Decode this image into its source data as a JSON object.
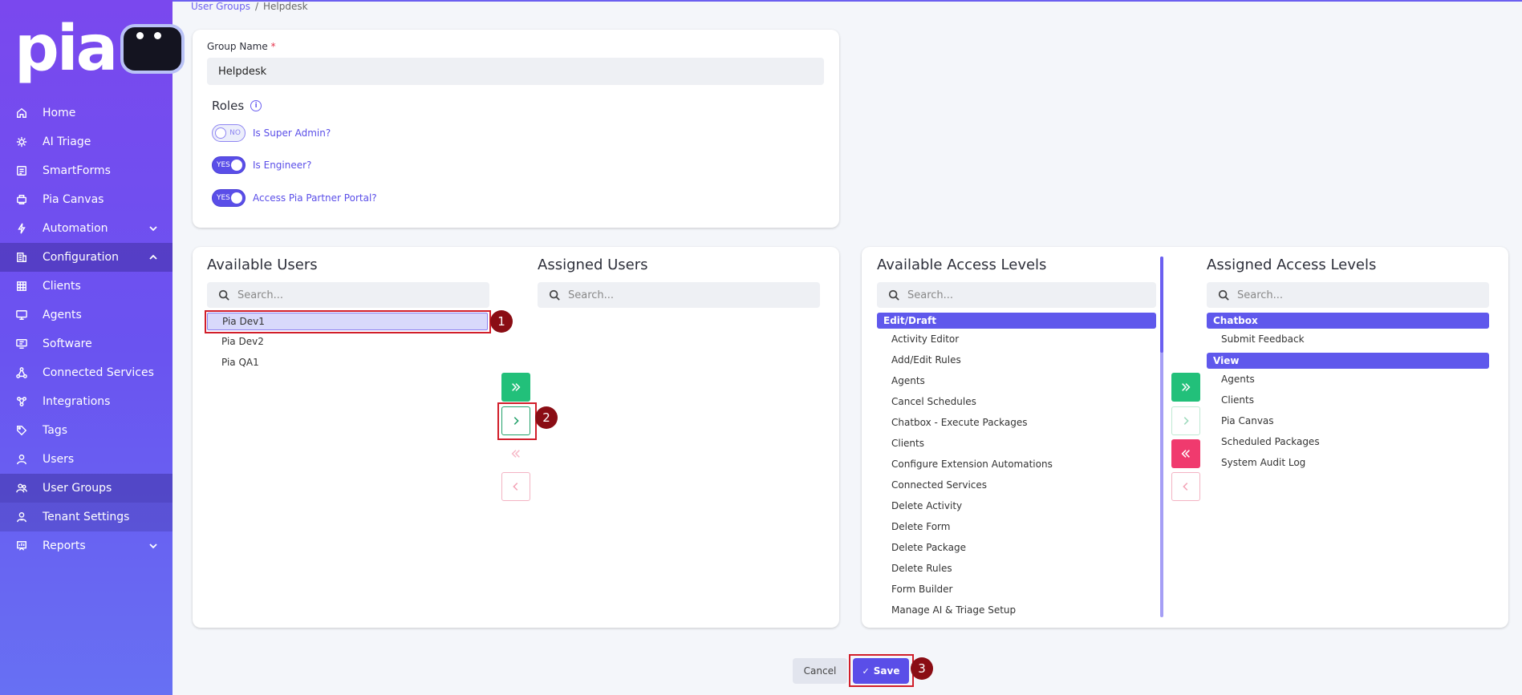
{
  "app": {
    "logo_text": "pia"
  },
  "sidebar": {
    "items": [
      {
        "label": "Home",
        "icon": "home-icon"
      },
      {
        "label": "AI Triage",
        "icon": "ai-triage-icon"
      },
      {
        "label": "SmartForms",
        "icon": "smartforms-icon"
      },
      {
        "label": "Pia Canvas",
        "icon": "canvas-icon"
      },
      {
        "label": "Automation",
        "icon": "automation-icon"
      },
      {
        "label": "Configuration",
        "icon": "configuration-icon"
      },
      {
        "label": "Clients",
        "icon": "clients-icon"
      },
      {
        "label": "Agents",
        "icon": "agents-icon"
      },
      {
        "label": "Software",
        "icon": "software-icon"
      },
      {
        "label": "Connected Services",
        "icon": "connected-services-icon"
      },
      {
        "label": "Integrations",
        "icon": "integrations-icon"
      },
      {
        "label": "Tags",
        "icon": "tag-icon"
      },
      {
        "label": "Users",
        "icon": "user-icon"
      },
      {
        "label": "User Groups",
        "icon": "user-groups-icon"
      },
      {
        "label": "Tenant Settings",
        "icon": "tenant-settings-icon"
      },
      {
        "label": "Reports",
        "icon": "reports-icon"
      }
    ]
  },
  "breadcrumb": {
    "parent": "User Groups",
    "separator": "/",
    "current": "Helpdesk"
  },
  "form": {
    "group_name_label": "Group Name",
    "required_mark": "*",
    "group_name_value": "Helpdesk",
    "roles_title": "Roles",
    "info_glyph": "i",
    "roles": [
      {
        "label": "Is Super Admin?",
        "state": "NO"
      },
      {
        "label": "Is Engineer?",
        "state": "YES"
      },
      {
        "label": "Access Pia Partner Portal?",
        "state": "YES"
      }
    ]
  },
  "users": {
    "available_title": "Available Users",
    "assigned_title": "Assigned Users",
    "search_placeholder": "Search...",
    "available": [
      "Pia Dev1",
      "Pia Dev2",
      "Pia QA1"
    ],
    "assigned": []
  },
  "access": {
    "available_title": "Available Access Levels",
    "assigned_title": "Assigned Access Levels",
    "search_placeholder": "Search...",
    "available_group": "Edit/Draft",
    "available": [
      "Activity Editor",
      "Add/Edit Rules",
      "Agents",
      "Cancel Schedules",
      "Chatbox - Execute Packages",
      "Clients",
      "Configure Extension Automations",
      "Connected Services",
      "Delete Activity",
      "Delete Form",
      "Delete Package",
      "Delete Rules",
      "Form Builder",
      "Manage AI & Triage Setup"
    ],
    "assigned_groups": [
      {
        "name": "Chatbox",
        "items": [
          "Submit Feedback"
        ]
      },
      {
        "name": "View",
        "items": [
          "Agents",
          "Clients",
          "Pia Canvas",
          "Scheduled Packages",
          "System Audit Log"
        ]
      }
    ]
  },
  "markers": [
    "1",
    "2",
    "3"
  ],
  "actions": {
    "cancel_label": "Cancel",
    "save_label": "Save",
    "save_check": "✓"
  },
  "colors": {
    "primary": "#5a4ee8",
    "success": "#22c07a",
    "danger": "#f03a6e",
    "annotation": "#d11e2a"
  }
}
